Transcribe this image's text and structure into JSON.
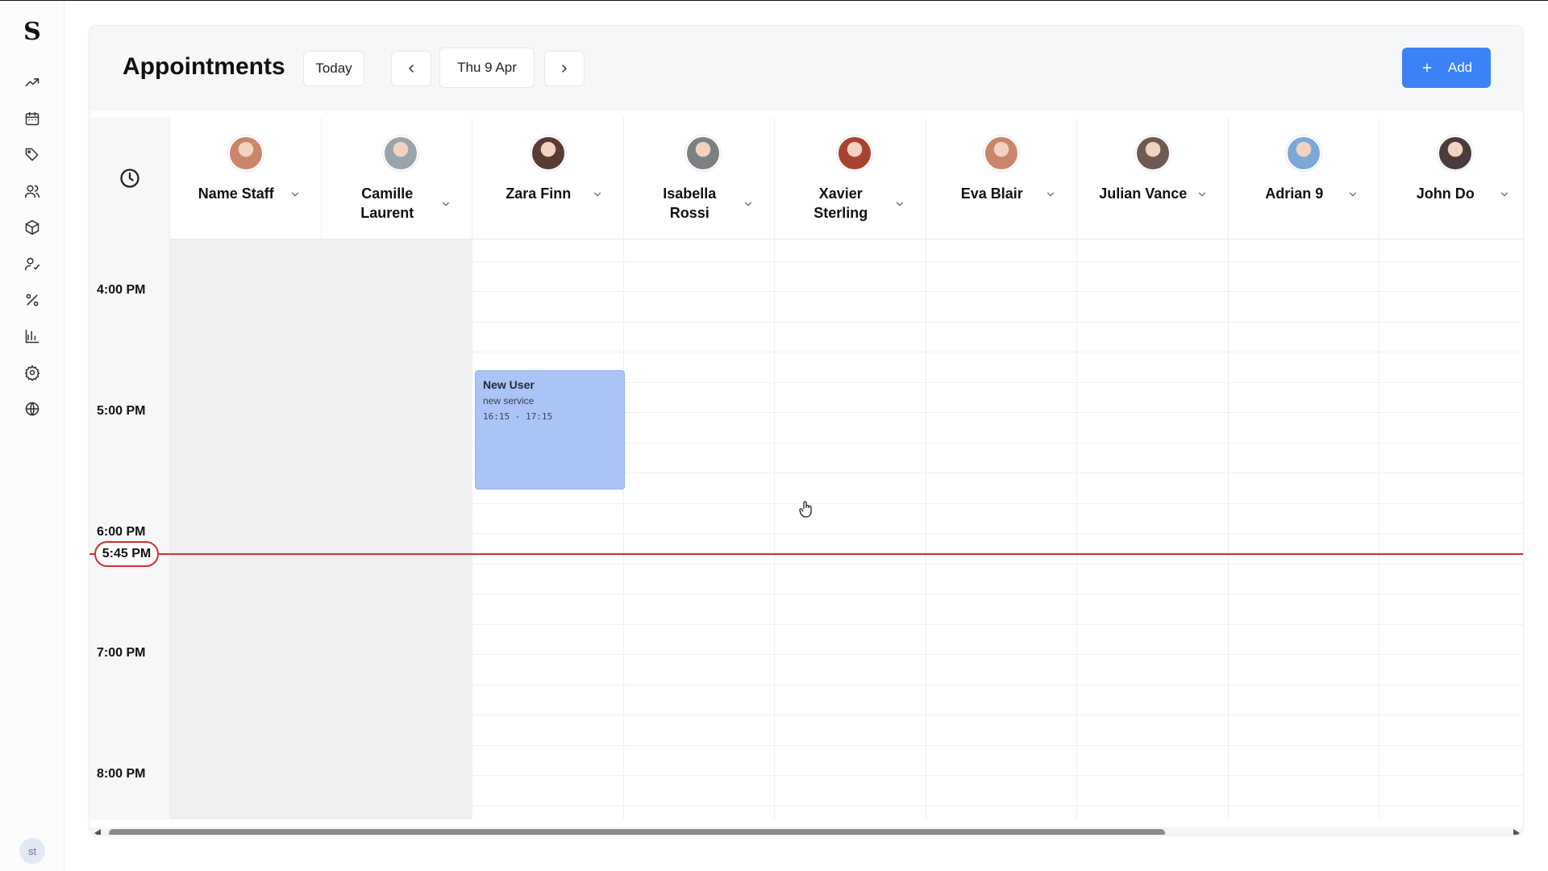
{
  "sidebar": {
    "logo": "S",
    "items": [
      {
        "name": "trend-icon"
      },
      {
        "name": "calendar-icon"
      },
      {
        "name": "tag-icon"
      },
      {
        "name": "users-icon"
      },
      {
        "name": "box-icon"
      },
      {
        "name": "user-check-icon"
      },
      {
        "name": "percent-icon"
      },
      {
        "name": "bar-chart-icon"
      },
      {
        "name": "gear-icon"
      },
      {
        "name": "globe-icon"
      }
    ],
    "user_initials": "st"
  },
  "header": {
    "title": "Appointments",
    "today_label": "Today",
    "date_label": "Thu 9 Apr",
    "add_label": "Add"
  },
  "staff": [
    {
      "line1": "Name Staff",
      "line2": "",
      "off": true,
      "avatar_color": "#c9866a"
    },
    {
      "line1": "Camille",
      "line2": "Laurent",
      "off": true,
      "avatar_color": "#9aa4ad"
    },
    {
      "line1": "Zara Finn",
      "line2": "",
      "off": false,
      "avatar_color": "#5a3b34"
    },
    {
      "line1": "Isabella",
      "line2": "Rossi",
      "off": false,
      "avatar_color": "#7d8083"
    },
    {
      "line1": "Xavier",
      "line2": "Sterling",
      "off": false,
      "avatar_color": "#a8432f"
    },
    {
      "line1": "Eva Blair",
      "line2": "",
      "off": false,
      "avatar_color": "#c9866a"
    },
    {
      "line1": "Julian Vance",
      "line2": "",
      "off": false,
      "avatar_color": "#6e5a52"
    },
    {
      "line1": "Adrian 9",
      "line2": "",
      "off": false,
      "avatar_color": "#7da7d9"
    },
    {
      "line1": "John Do",
      "line2": "",
      "off": false,
      "avatar_color": "#4a3c3a"
    }
  ],
  "time_labels": [
    "4:00 PM",
    "5:00 PM",
    "6:00 PM",
    "7:00 PM",
    "8:00 PM"
  ],
  "current_time": "5:45 PM",
  "appointment": {
    "title": "New User",
    "service": "new service",
    "time": "16:15 - 17:15"
  },
  "colors": {
    "accent": "#3b82f6",
    "now_line": "#d32f2f",
    "appointment_bg": "#aac4f6"
  }
}
